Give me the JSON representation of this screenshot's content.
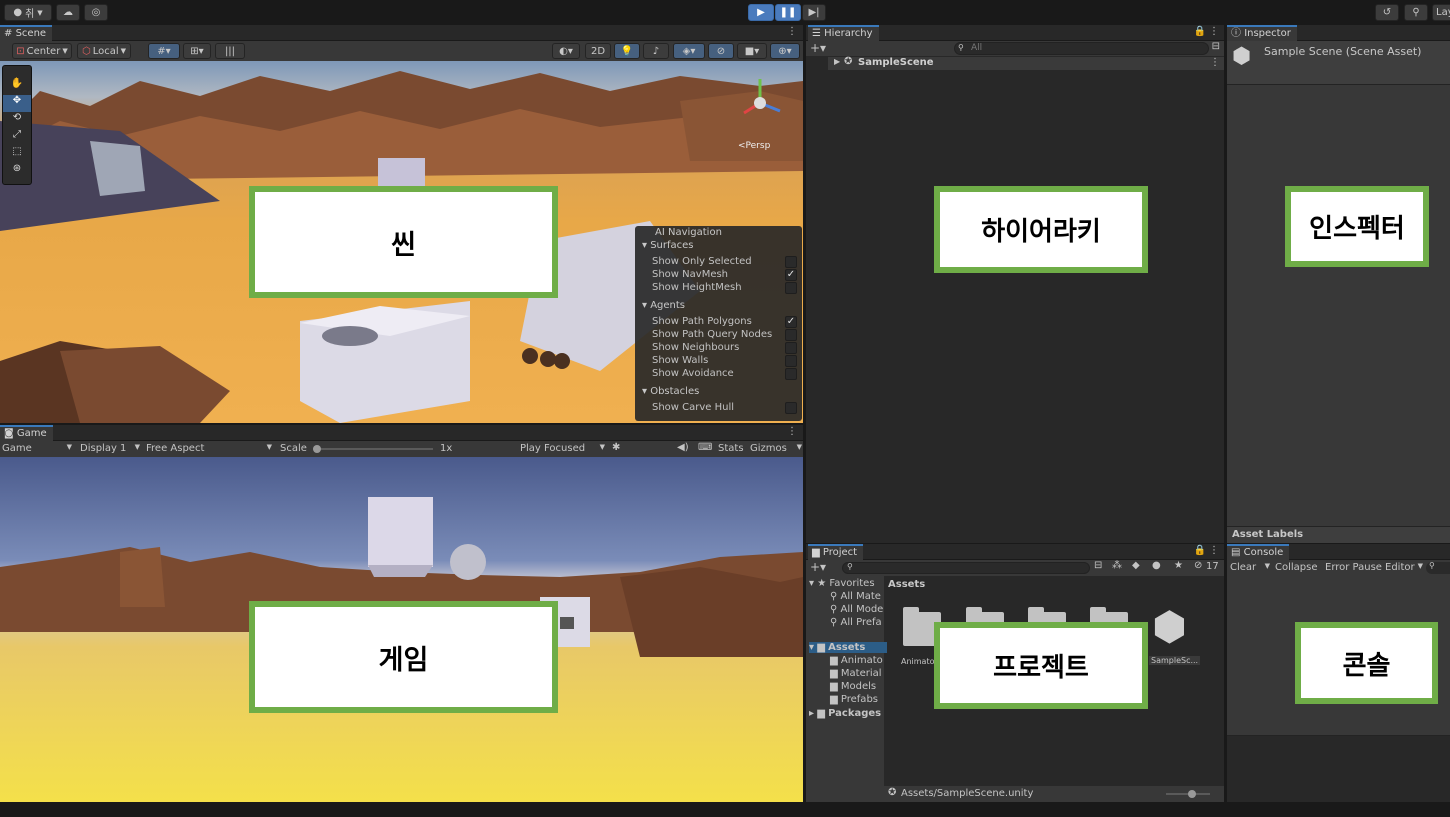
{
  "toolbar": {
    "account_label": "취",
    "layout_label": "Lay"
  },
  "scene": {
    "tab": "Scene",
    "pivot": "Center",
    "space": "Local",
    "mode_2d": "2D",
    "persp_label": "<Persp",
    "overlay_label": "씬"
  },
  "ai_nav": {
    "title": "AI Navigation",
    "surfaces": "Surfaces",
    "show_only_selected": "Show Only Selected",
    "show_navmesh": "Show NavMesh",
    "show_heightmesh": "Show HeightMesh",
    "agents": "Agents",
    "show_path_polygons": "Show Path Polygons",
    "show_path_query_nodes": "Show Path Query Nodes",
    "show_neighbours": "Show Neighbours",
    "show_walls": "Show Walls",
    "show_avoidance": "Show Avoidance",
    "obstacles": "Obstacles",
    "show_carve_hull": "Show Carve Hull",
    "check_mark": "✓"
  },
  "game": {
    "tab": "Game",
    "mode": "Game",
    "display": "Display 1",
    "aspect": "Free Aspect",
    "scale_label": "Scale",
    "scale_value": "1x",
    "play_mode": "Play Focused",
    "stats": "Stats",
    "gizmos": "Gizmos",
    "overlay_label": "게임"
  },
  "hierarchy": {
    "tab": "Hierarchy",
    "search_placeholder": "All",
    "scene_name": "SampleScene",
    "overlay_label": "하이어라키"
  },
  "inspector": {
    "tab": "Inspector",
    "title": "Sample Scene (Scene Asset)",
    "asset_labels": "Asset Labels",
    "overlay_label": "인스펙터"
  },
  "project": {
    "tab": "Project",
    "hidden_count": "17",
    "favorites": "Favorites",
    "fav_items": [
      "All Mate",
      "All Mode",
      "All Prefa"
    ],
    "assets_root": "Assets",
    "asset_folders": [
      "Animato",
      "Material",
      "Models",
      "Prefabs"
    ],
    "packages": "Packages",
    "breadcrumb": "Assets",
    "grid_items": [
      "Animato",
      "",
      "",
      "",
      "SampleSc..."
    ],
    "footer_path": "Assets/SampleScene.unity",
    "overlay_label": "프로젝트"
  },
  "console": {
    "tab": "Console",
    "clear": "Clear",
    "collapse": "Collapse",
    "error_pause": "Error Pause",
    "editor": "Editor",
    "overlay_label": "콘솔"
  }
}
